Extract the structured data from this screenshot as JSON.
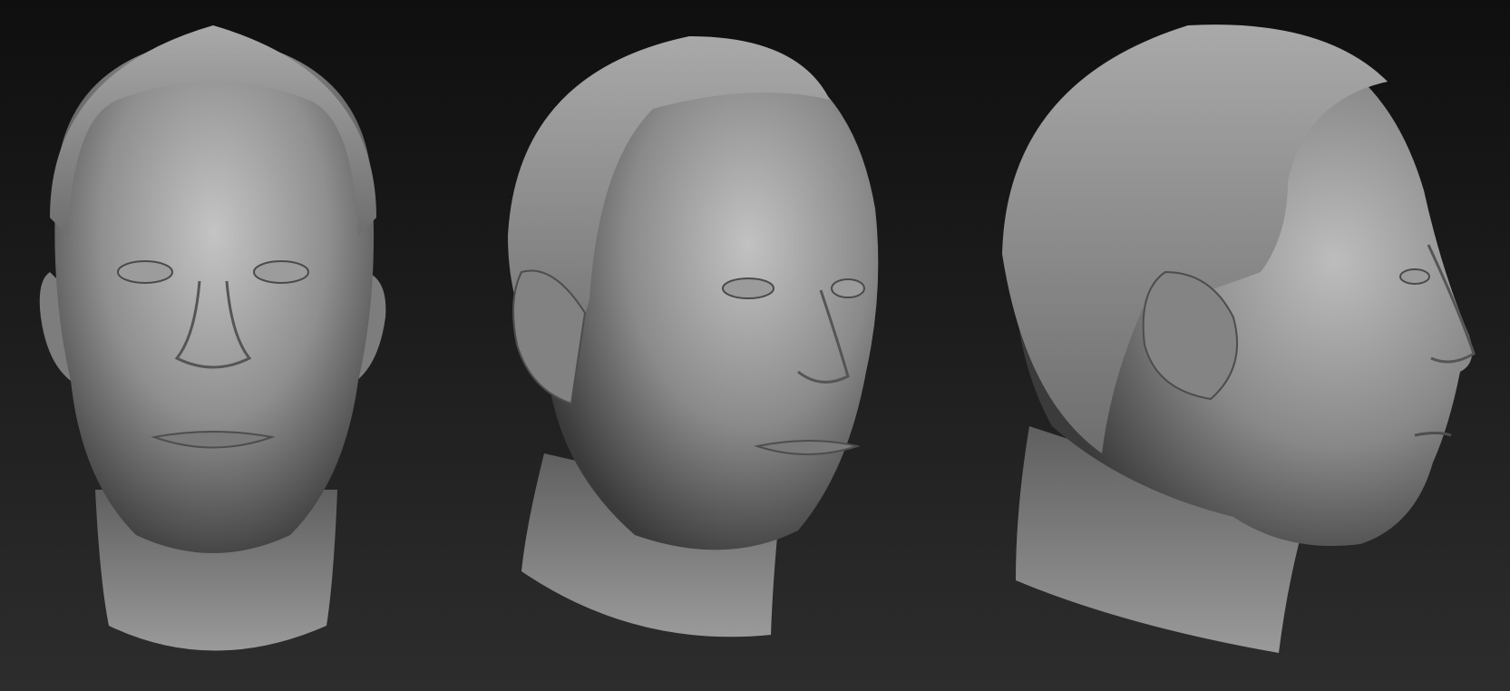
{
  "scene": {
    "background_top": "#0f0f0f",
    "background_bottom": "#2d2d2d",
    "material_color": "#8c8c8c",
    "views": [
      {
        "name": "front-view"
      },
      {
        "name": "three-quarter-view"
      },
      {
        "name": "side-view"
      }
    ]
  }
}
